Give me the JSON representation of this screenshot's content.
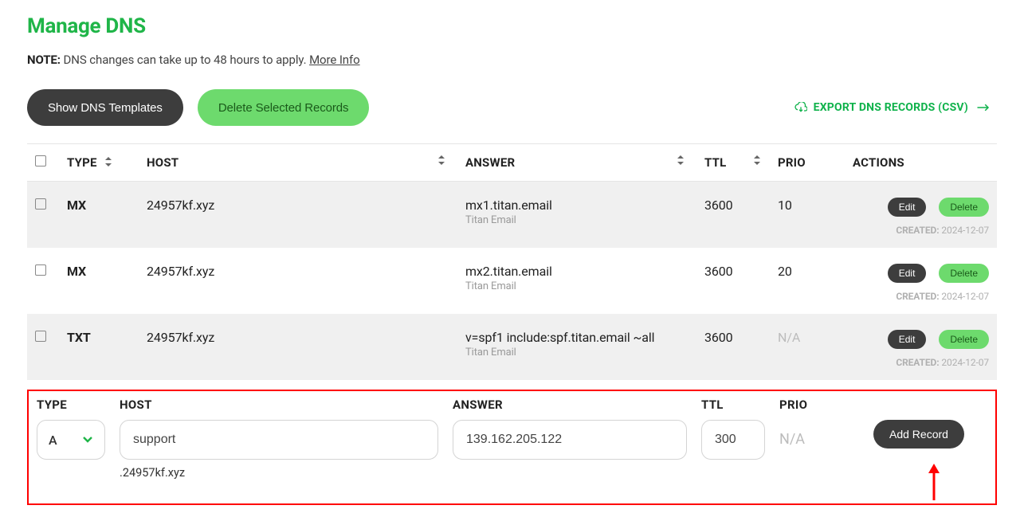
{
  "title": "Manage DNS",
  "note": {
    "label": "NOTE:",
    "text": "DNS changes can take up to 48 hours to apply.",
    "link": "More Info"
  },
  "toolbar": {
    "templates": "Show DNS Templates",
    "deleteSel": "Delete Selected Records",
    "export": "EXPORT DNS RECORDS (CSV)"
  },
  "headers": {
    "type": "TYPE",
    "host": "HOST",
    "answer": "ANSWER",
    "ttl": "TTL",
    "prio": "PRIO",
    "actions": "ACTIONS"
  },
  "actions": {
    "edit": "Edit",
    "delete": "Delete",
    "createdLabel": "CREATED:"
  },
  "records": [
    {
      "type": "MX",
      "host": "24957kf.xyz",
      "answer": "mx1.titan.email",
      "sub": "Titan Email",
      "ttl": "3600",
      "prio": "10",
      "created": "2024-12-07"
    },
    {
      "type": "MX",
      "host": "24957kf.xyz",
      "answer": "mx2.titan.email",
      "sub": "Titan Email",
      "ttl": "3600",
      "prio": "20",
      "created": "2024-12-07"
    },
    {
      "type": "TXT",
      "host": "24957kf.xyz",
      "answer": "v=spf1 include:spf.titan.email ~all",
      "sub": "Titan Email",
      "ttl": "3600",
      "prio": "N/A",
      "created": "2024-12-07"
    }
  ],
  "form": {
    "labels": {
      "type": "TYPE",
      "host": "HOST",
      "answer": "ANSWER",
      "ttl": "TTL",
      "prio": "PRIO"
    },
    "type": "A",
    "host": "support",
    "hostSuffix": ".24957kf.xyz",
    "answer": "139.162.205.122",
    "ttl": "300",
    "prio": "N/A",
    "addBtn": "Add Record"
  }
}
